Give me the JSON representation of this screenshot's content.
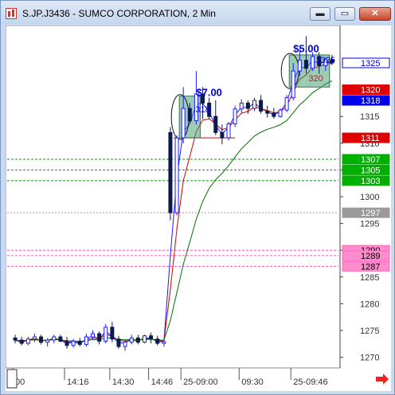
{
  "window": {
    "title": "S.JP.J3436 - SUMCO CORPORATION, 2 Min",
    "minimize_glyph": "▬",
    "maximize_glyph": "▭",
    "close_glyph": "✕"
  },
  "icons": {
    "app": "chart-app-icon",
    "scroll_right": "red-arrow-right-icon"
  },
  "colors": {
    "up": "#1a1aff",
    "down": "#0b1a4d",
    "ma_fast": "#1a1aff",
    "ma_mid": "#d00000",
    "ma_slow": "#007000",
    "box_fill": "#3a9a6a"
  },
  "chart_data": {
    "type": "candlestick",
    "ylim": [
      1268,
      1332
    ],
    "y_ticks": [
      1270,
      1275,
      1280,
      1285,
      1290,
      1295,
      1300,
      1305,
      1310,
      1315
    ],
    "x_labels": [
      "00",
      "14:16",
      "14:30",
      "14:46",
      "25-09:00",
      "09:30",
      "25-09:46"
    ],
    "price_tags": [
      {
        "value": 1325,
        "label": "1325",
        "style": "blue-outline"
      },
      {
        "value": 1320,
        "label": "1320",
        "style": "red"
      },
      {
        "value": 1318,
        "label": "1318",
        "style": "blue"
      },
      {
        "value": 1311,
        "label": "1311",
        "style": "red"
      },
      {
        "value": 1307,
        "label": "1307",
        "style": "green"
      },
      {
        "value": 1305,
        "label": "1305",
        "style": "green"
      },
      {
        "value": 1303,
        "label": "1303",
        "style": "green"
      },
      {
        "value": 1297,
        "label": "1297",
        "style": "gray"
      },
      {
        "value": 1290,
        "label": "1290",
        "style": "pink"
      },
      {
        "value": 1289,
        "label": "1289",
        "style": "pink"
      },
      {
        "value": 1287,
        "label": "1287",
        "style": "pink"
      }
    ],
    "annotations": [
      {
        "text": "$7.00",
        "value": 1319.4
      },
      {
        "text": "318",
        "value": 1316.4
      },
      {
        "text": "$5.00",
        "value": 1327.6
      },
      {
        "text": "1325",
        "value": 1325.6
      },
      {
        "text": "320",
        "value": 1322.2
      }
    ],
    "candles": [
      [
        1273.6,
        1274.2,
        1272.6,
        1273.2
      ],
      [
        1273.2,
        1273.8,
        1272.2,
        1272.6
      ],
      [
        1272.6,
        1273.8,
        1272.2,
        1273.4
      ],
      [
        1273.4,
        1274.4,
        1272.8,
        1273.8
      ],
      [
        1273.8,
        1274.2,
        1272.4,
        1272.8
      ],
      [
        1272.8,
        1273.6,
        1272.0,
        1273.2
      ],
      [
        1273.2,
        1274.2,
        1272.6,
        1273.8
      ],
      [
        1273.8,
        1274.2,
        1272.8,
        1273.0
      ],
      [
        1273.0,
        1273.8,
        1271.6,
        1272.2
      ],
      [
        1272.2,
        1273.4,
        1271.8,
        1273.0
      ],
      [
        1273.0,
        1273.6,
        1272.0,
        1272.4
      ],
      [
        1272.4,
        1274.4,
        1272.0,
        1273.8
      ],
      [
        1273.8,
        1275.0,
        1273.2,
        1274.4
      ],
      [
        1274.4,
        1274.8,
        1272.4,
        1273.0
      ],
      [
        1273.0,
        1276.2,
        1272.6,
        1275.6
      ],
      [
        1275.6,
        1276.6,
        1272.8,
        1273.4
      ],
      [
        1273.4,
        1274.0,
        1271.6,
        1272.0
      ],
      [
        1272.0,
        1273.2,
        1271.2,
        1272.8
      ],
      [
        1272.8,
        1274.2,
        1272.4,
        1273.6
      ],
      [
        1273.6,
        1274.2,
        1272.4,
        1272.8
      ],
      [
        1272.8,
        1274.2,
        1272.6,
        1274.0
      ],
      [
        1274.0,
        1274.6,
        1272.6,
        1273.4
      ],
      [
        1273.4,
        1274.0,
        1272.2,
        1272.6
      ],
      [
        1272.6,
        1273.4,
        1272.0,
        1272.9
      ],
      [
        1312.0,
        1313.0,
        1295.6,
        1297.0
      ],
      [
        1297.0,
        1311.5,
        1296.5,
        1311.0
      ],
      [
        1311.0,
        1320.5,
        1310.0,
        1316.5
      ],
      [
        1316.5,
        1317.5,
        1313.8,
        1314.2
      ],
      [
        1314.2,
        1323.5,
        1313.5,
        1319.2
      ],
      [
        1319.2,
        1320.5,
        1314.5,
        1317.5
      ],
      [
        1317.5,
        1318.5,
        1314.5,
        1315.0
      ],
      [
        1315.0,
        1318.0,
        1311.5,
        1312.0
      ],
      [
        1312.0,
        1313.5,
        1309.8,
        1311.0
      ],
      [
        1311.0,
        1314.0,
        1310.5,
        1313.6
      ],
      [
        1313.6,
        1317.0,
        1313.0,
        1316.4
      ],
      [
        1316.4,
        1318.2,
        1315.6,
        1317.5
      ],
      [
        1317.5,
        1318.0,
        1315.5,
        1316.5
      ],
      [
        1316.5,
        1318.5,
        1316.0,
        1318.0
      ],
      [
        1318.0,
        1319.0,
        1315.5,
        1316.0
      ],
      [
        1316.0,
        1317.0,
        1314.8,
        1315.6
      ],
      [
        1315.6,
        1316.6,
        1314.6,
        1315.0
      ],
      [
        1315.0,
        1316.5,
        1314.8,
        1316.2
      ],
      [
        1316.2,
        1319.0,
        1315.8,
        1318.5
      ],
      [
        1318.5,
        1325.0,
        1318.0,
        1323.5
      ],
      [
        1323.5,
        1327.5,
        1322.5,
        1325.5
      ],
      [
        1325.5,
        1330.0,
        1323.0,
        1324.0
      ],
      [
        1324.0,
        1327.0,
        1323.5,
        1326.2
      ],
      [
        1326.2,
        1327.0,
        1323.0,
        1324.5
      ],
      [
        1324.5,
        1326.0,
        1323.5,
        1325.6
      ],
      [
        1325.6,
        1326.5,
        1324.6,
        1325.0
      ]
    ]
  }
}
